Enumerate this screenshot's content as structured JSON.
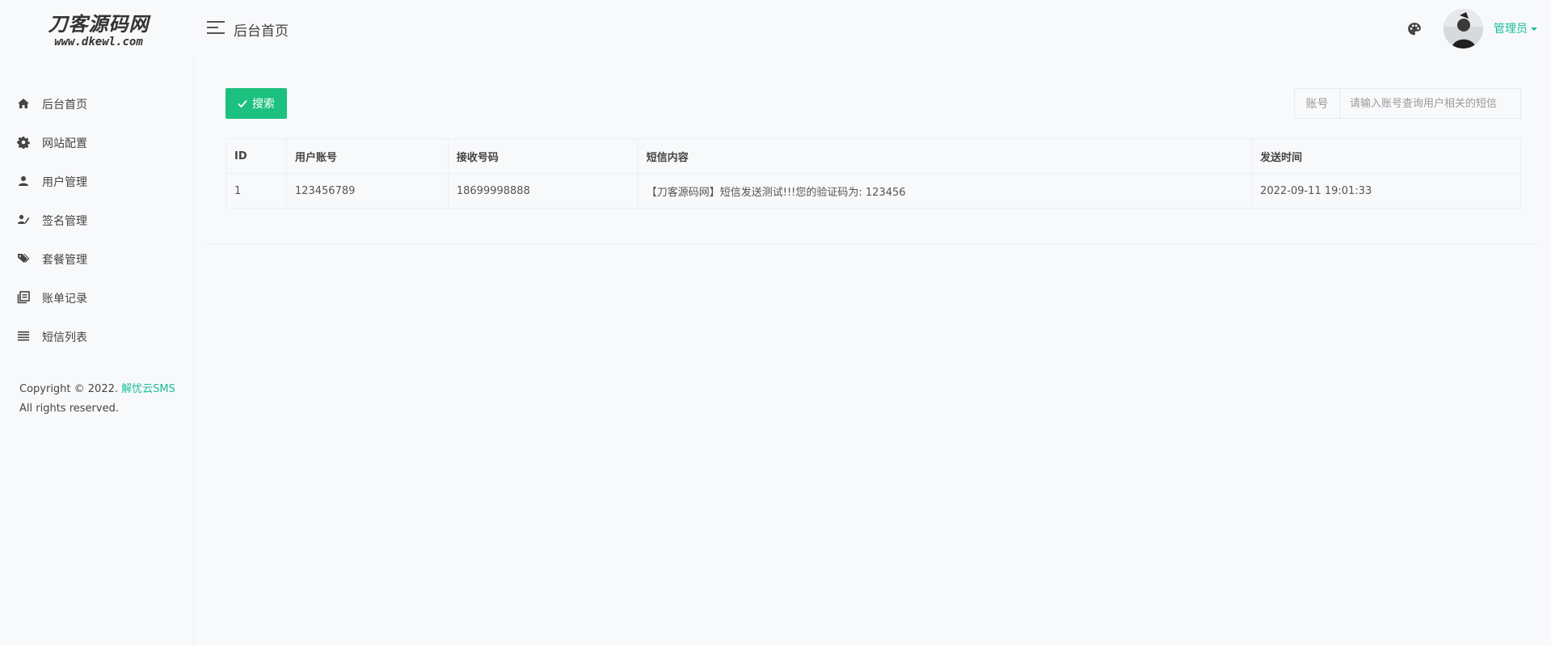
{
  "logo": {
    "main": "刀客源码网",
    "sub": "www.dkewl.com"
  },
  "header": {
    "title": "后台首页",
    "user": "管理员"
  },
  "sidebar": {
    "items": [
      {
        "label": "后台首页",
        "icon": "home-icon"
      },
      {
        "label": "网站配置",
        "icon": "gear-icon"
      },
      {
        "label": "用户管理",
        "icon": "user-icon"
      },
      {
        "label": "签名管理",
        "icon": "signature-icon"
      },
      {
        "label": "套餐管理",
        "icon": "tags-icon"
      },
      {
        "label": "账单记录",
        "icon": "records-icon"
      },
      {
        "label": "短信列表",
        "icon": "list-icon"
      }
    ],
    "copyright_prefix": "Copyright © 2022.",
    "copyright_link": "解忧云SMS",
    "copyright_suffix": "All rights reserved."
  },
  "toolbar": {
    "search_label": "搜索"
  },
  "filter": {
    "label": "账号",
    "placeholder": "请输入账号查询用户相关的短信"
  },
  "table": {
    "headers": [
      "ID",
      "用户账号",
      "接收号码",
      "短信内容",
      "发送时间"
    ],
    "rows": [
      [
        "1",
        "123456789",
        "18699998888",
        "【刀客源码网】短信发送测试!!!您的验证码为: 123456",
        "2022-09-11 19:01:33"
      ]
    ]
  },
  "colors": {
    "accent": "#1abc9c",
    "button": "#1dc17f"
  }
}
